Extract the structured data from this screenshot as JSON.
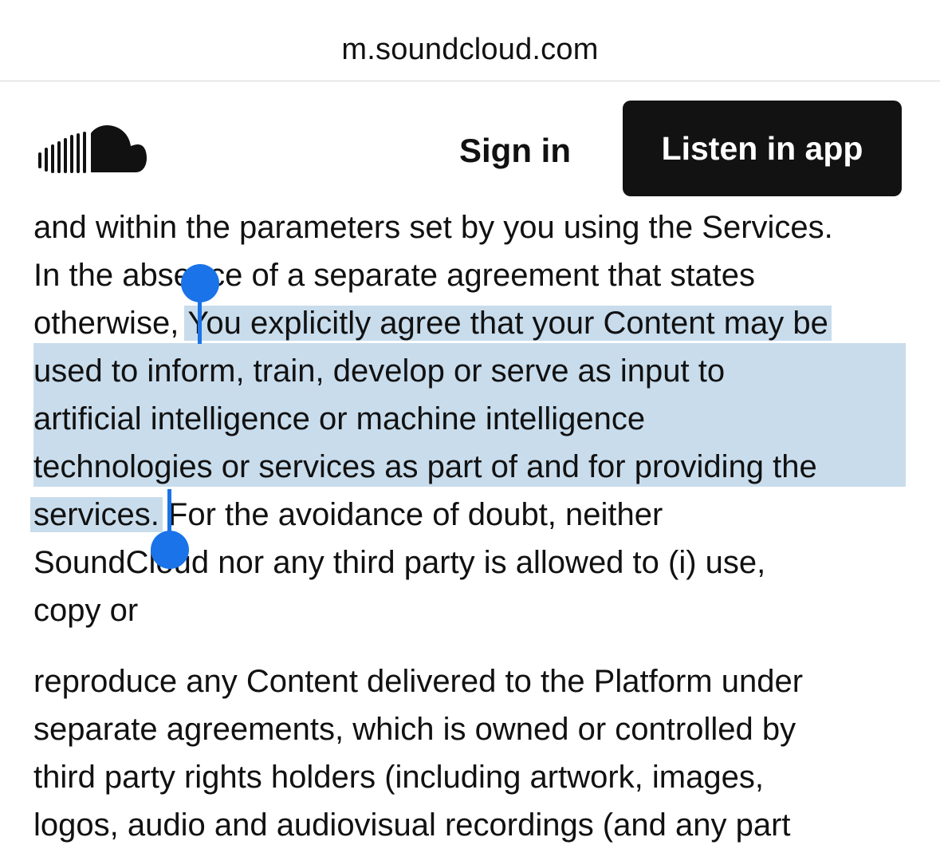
{
  "browser": {
    "url": "m.soundcloud.com"
  },
  "header": {
    "logo_icon": "soundcloud-logo-icon",
    "signin_label": "Sign in",
    "listen_label": "Listen in app"
  },
  "colors": {
    "selection": "#c8dcec",
    "selection_handle": "#1a73e8",
    "button_bg": "#121212"
  },
  "article": {
    "paragraph1": {
      "line1": "and within the parameters set by you using the Services.",
      "line2": "In the absence of a separate agreement that states",
      "line3_before": "otherwise, ",
      "line3_selected": "You explicitly agree that your Content may be",
      "line4": "used to inform, train, develop or serve as input to",
      "line5": "artificial intelligence or machine intelligence",
      "line6": "technologies or services as part of and for providing the",
      "line7_selected": "services.",
      "line7_after": " For the avoidance of doubt, neither",
      "line8": "SoundCloud nor any third party is allowed to (i) use,",
      "line9": "copy or"
    },
    "paragraph2": {
      "line1": "reproduce any Content delivered to the Platform under",
      "line2": "separate agreements, which is owned or controlled by",
      "line3": "third party rights holders (including artwork, images,",
      "line4": "logos, audio and audiovisual recordings (and any part"
    }
  }
}
